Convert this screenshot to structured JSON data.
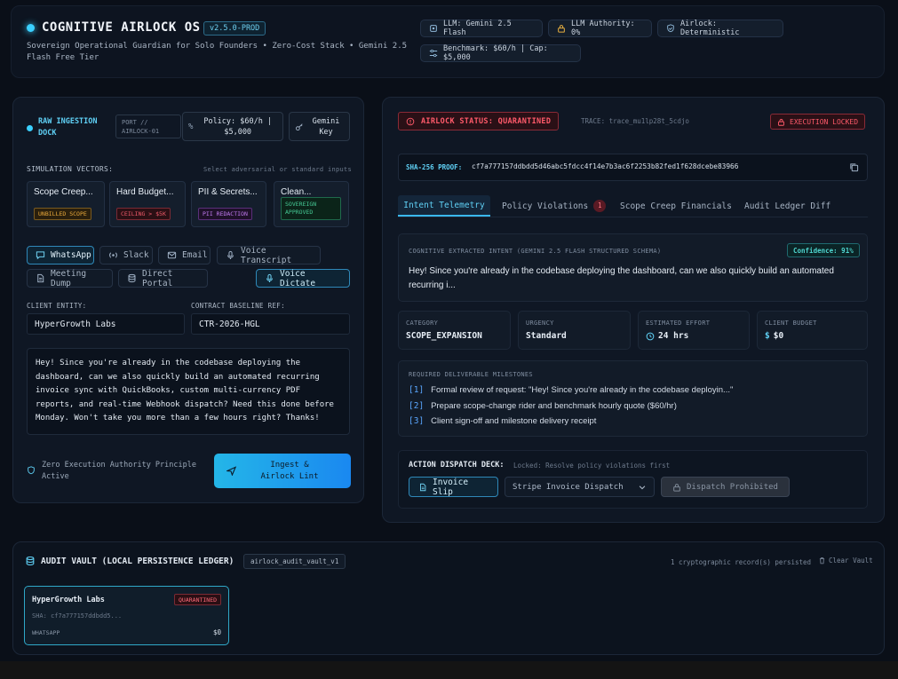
{
  "header": {
    "title": "COGNITIVE AIRLOCK OS",
    "version": "v2.5.0-PROD",
    "subtitle": "Sovereign Operational Guardian for Solo Founders • Zero-Cost Stack • Gemini 2.5 Flash Free Tier",
    "chips": [
      {
        "icon": "chip-icon",
        "text": "LLM: Gemini 2.5 Flash"
      },
      {
        "icon": "lock-icon",
        "text": "LLM Authority: 0%"
      },
      {
        "icon": "shield-check-icon",
        "text": "Airlock: Deterministic"
      },
      {
        "icon": "sliders-icon",
        "text": "Benchmark: $60/h | Cap: $5,000"
      }
    ]
  },
  "ingestion": {
    "title": "RAW INGESTION DOCK",
    "port": "PORT // AIRLOCK-01",
    "policy": "Policy: $60/h | $5,000",
    "gemini_key": "Gemini Key",
    "vectors_label": "SIMULATION VECTORS:",
    "vectors_hint": "Select adversarial or standard inputs",
    "vectors": [
      {
        "title": "Scope Creep...",
        "tag": "UNBILLED SCOPE",
        "color": "#e0a030"
      },
      {
        "title": "Hard Budget...",
        "tag": "CEILING > $5K",
        "color": "#e05060"
      },
      {
        "title": "PII & Secrets...",
        "tag": "PII REDACTION",
        "color": "#b070e0"
      },
      {
        "title": "Clean...",
        "tag": "SOVEREIGN APPROVED",
        "color": "#40c090"
      }
    ],
    "sources": [
      {
        "label": "WhatsApp",
        "icon": "message-icon",
        "active": true
      },
      {
        "label": "Slack",
        "icon": "radio-icon",
        "active": false
      },
      {
        "label": "Email",
        "icon": "mail-icon",
        "active": false
      },
      {
        "label": "Voice Transcript",
        "icon": "mic-icon",
        "active": false
      },
      {
        "label": "Meeting Dump",
        "icon": "document-icon",
        "active": false
      },
      {
        "label": "Direct Portal",
        "icon": "database-icon",
        "active": false
      }
    ],
    "voice_dictate": "Voice Dictate",
    "client_entity_label": "CLIENT ENTITY:",
    "client_entity_value": "HyperGrowth Labs",
    "contract_label": "CONTRACT BASELINE REF:",
    "contract_value": "CTR-2026-HGL",
    "message": "Hey! Since you're already in the codebase deploying the dashboard, can we also quickly build an automated recurring invoice sync with QuickBooks, custom multi-currency PDF reports, and real-time Webhook dispatch? Need this done before Monday. Won't take you more than a few hours right? Thanks!",
    "principle": "Zero Execution Authority Principle Active",
    "ingest_button": "Ingest & Airlock Lint"
  },
  "airlock": {
    "status": "AIRLOCK STATUS: QUARANTINED",
    "trace": "TRACE: trace_mu1lp28t_5cdjo",
    "execution": "EXECUTION LOCKED",
    "sha_label": "SHA-256 PROOF:",
    "sha_value": "cf7a777157ddbdd5d46abc5fdcc4f14e7b3ac6f2253b82fed1f628dcebe83966",
    "tabs": [
      {
        "label": "Intent Telemetry",
        "active": true
      },
      {
        "label": "Policy Violations",
        "badge": "1"
      },
      {
        "label": "Scope Creep Financials"
      },
      {
        "label": "Audit Ledger Diff"
      }
    ],
    "intent_label": "COGNITIVE EXTRACTED INTENT (GEMINI 2.5 FLASH STRUCTURED SCHEMA)",
    "confidence": "Confidence: 91%",
    "intent_text": "Hey! Since you're already in the codebase deploying the dashboard, can we also quickly build an automated recurring i...",
    "metrics": [
      {
        "key": "CATEGORY",
        "value": "SCOPE_EXPANSION"
      },
      {
        "key": "URGENCY",
        "value": "Standard"
      },
      {
        "key": "ESTIMATED EFFORT",
        "value": "24 hrs",
        "icon": "clock-icon"
      },
      {
        "key": "CLIENT BUDGET",
        "value": "$0",
        "icon": "dollar-icon"
      }
    ],
    "milestones_label": "REQUIRED DELIVERABLE MILESTONES",
    "milestones": [
      {
        "n": "[1]",
        "text": "Formal review of request: \"Hey! Since you're already in the codebase deployin...\""
      },
      {
        "n": "[2]",
        "text": "Prepare scope-change rider and benchmark hourly quote ($60/hr)"
      },
      {
        "n": "[3]",
        "text": "Client sign-off and milestone delivery receipt"
      }
    ],
    "dispatch_label": "ACTION DISPATCH DECK:",
    "dispatch_hint": "Locked: Resolve policy violations first",
    "invoice_slip": "Invoice Slip",
    "stripe_select": "Stripe Invoice Dispatch",
    "dispatch_prohibited": "Dispatch Prohibited"
  },
  "vault": {
    "title": "AUDIT VAULT (LOCAL PERSISTENCE LEDGER)",
    "key": "airlock_audit_vault_v1",
    "records": "1 cryptographic record(s) persisted",
    "clear": "Clear Vault",
    "entries": [
      {
        "client": "HyperGrowth Labs",
        "status": "QUARANTINED",
        "sha": "SHA: cf7a777157ddbdd5...",
        "source": "WHATSAPP",
        "amount": "$0"
      }
    ]
  }
}
